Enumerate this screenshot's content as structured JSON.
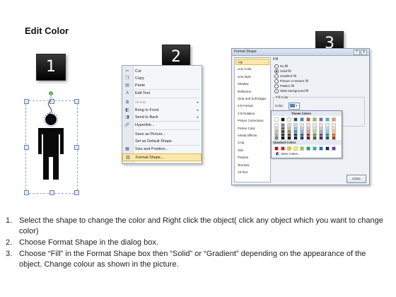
{
  "title": "Edit Color",
  "badges": [
    "1",
    "2",
    "3"
  ],
  "context_menu": {
    "items": [
      {
        "icon": "scissors-icon",
        "glyph": "✂",
        "label": "Cut",
        "arrow": ""
      },
      {
        "icon": "copy-icon",
        "glyph": "❐",
        "label": "Copy",
        "arrow": ""
      },
      {
        "icon": "paste-icon",
        "glyph": "▤",
        "label": "Paste",
        "arrow": ""
      },
      {
        "icon": "edit-text-icon",
        "glyph": "A",
        "label": "Edit Text",
        "arrow": ""
      },
      {
        "icon": "group-icon",
        "glyph": "⧉",
        "label": "Group",
        "arrow": "▸"
      },
      {
        "icon": "bring-to-front-icon",
        "glyph": "◧",
        "label": "Bring to Front",
        "arrow": "▸"
      },
      {
        "icon": "send-to-back-icon",
        "glyph": "◨",
        "label": "Send to Back",
        "arrow": "▸"
      },
      {
        "icon": "hyperlink-icon",
        "glyph": "🔗",
        "label": "Hyperlink...",
        "arrow": ""
      },
      {
        "icon": "save-picture-icon",
        "glyph": "",
        "label": "Save as Picture...",
        "arrow": ""
      },
      {
        "icon": "default-shape-icon",
        "glyph": "",
        "label": "Set as Default Shape",
        "arrow": ""
      },
      {
        "icon": "size-position-icon",
        "glyph": "▦",
        "label": "Size and Position...",
        "arrow": ""
      },
      {
        "icon": "format-shape-icon",
        "glyph": "▧",
        "label": "Format Shape...",
        "arrow": ""
      }
    ]
  },
  "dialog": {
    "title": "Format Shape",
    "title_buttons": [
      "?",
      "X"
    ],
    "categories": [
      "Fill",
      "Line Color",
      "Line Style",
      "Shadow",
      "Reflection",
      "Glow and Soft Edges",
      "3-D Format",
      "3-D Rotation",
      "Picture Corrections",
      "Picture Color",
      "Artistic Effects",
      "Crop",
      "Size",
      "Position",
      "Text Box",
      "Alt Text"
    ],
    "selected_category": "Fill",
    "pane_heading": "Fill",
    "fill_options": [
      "No fill",
      "Solid fill",
      "Gradient fill",
      "Picture or texture fill",
      "Pattern fill",
      "Slide background fill"
    ],
    "selected_fill": "Solid fill",
    "fill_color_group": "Fill Color",
    "color_label": "Color:",
    "transparency_label": "Transpar",
    "theme_colors_label": "Theme Colors",
    "standard_colors_label": "Standard Colors",
    "more_colors_label": "More Colors...",
    "close_label": "Close"
  },
  "palette": {
    "theme_top": [
      "#ffffff",
      "#000000",
      "#eeece1",
      "#1f497d",
      "#4f81bd",
      "#c0504d",
      "#9bbb59",
      "#8064a2",
      "#4bacc6",
      "#f79646"
    ],
    "theme_shades": [
      [
        "#f2f2f2",
        "#7f7f7f",
        "#ddd9c3",
        "#c6d9f0",
        "#dbe5f1",
        "#f2dcdb",
        "#ebf1dd",
        "#e5e0ec",
        "#dbeef3",
        "#fdeada"
      ],
      [
        "#d8d8d8",
        "#595959",
        "#c4bd97",
        "#8db3e2",
        "#b8cce4",
        "#e5b9b7",
        "#d7e3bc",
        "#ccc1d9",
        "#b7dde8",
        "#fbd5b5"
      ],
      [
        "#bfbfbf",
        "#3f3f3f",
        "#938953",
        "#548dd4",
        "#95b3d7",
        "#d99694",
        "#c3d69b",
        "#b2a2c7",
        "#92cddc",
        "#fac08f"
      ],
      [
        "#a5a5a5",
        "#262626",
        "#494429",
        "#17365d",
        "#366092",
        "#953734",
        "#76923c",
        "#5f497a",
        "#31859b",
        "#e36c09"
      ],
      [
        "#7f7f7f",
        "#0c0c0c",
        "#1d1b10",
        "#0f243e",
        "#244061",
        "#632423",
        "#4f6128",
        "#3f3151",
        "#205867",
        "#974806"
      ]
    ],
    "standard": [
      "#c00000",
      "#ff0000",
      "#ffc000",
      "#ffff00",
      "#92d050",
      "#00b050",
      "#00b0f0",
      "#0070c0",
      "#002060",
      "#7030a0"
    ]
  },
  "instructions": [
    {
      "num": "1.",
      "text": "Select the shape to change the color and Right click the object( click any object which you want to change color)"
    },
    {
      "num": "2.",
      "text": "Choose Format Shape in the dialog box."
    },
    {
      "num": "3.",
      "text": "Choose “Fill” in the Format Shape box then “Solid” or “Gradient” depending on the appearance of the object. Change colour as shown in the picture."
    }
  ]
}
